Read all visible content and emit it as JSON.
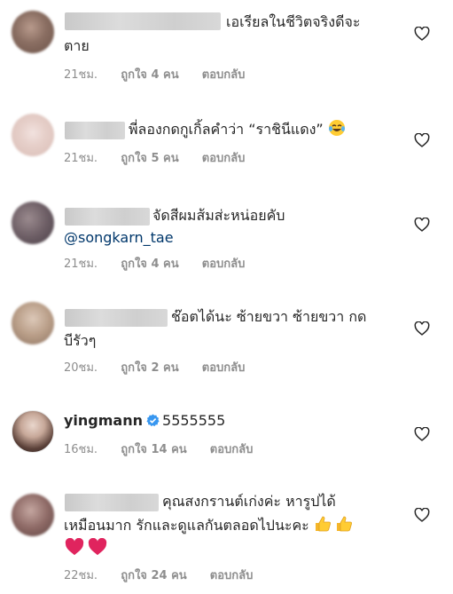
{
  "comments": [
    {
      "username": "",
      "line1": "เอเรียลในชีวิตจริงดีจะ",
      "line2": "ตาย",
      "time": "21ชม.",
      "likes": "ถูกใจ 4 คน",
      "reply": "ตอบกลับ"
    },
    {
      "username": "",
      "line1": "พี่ลองกดกูเกิ้ลคำว่า “ราชินีแดง”",
      "time": "21ชม.",
      "likes": "ถูกใจ 5 คน",
      "reply": "ตอบกลับ"
    },
    {
      "username": "",
      "line1": "จัดสีผมส้มส่ะหน่อยคับ",
      "mention": "@songkarn_tae",
      "time": "21ชม.",
      "likes": "ถูกใจ 4 คน",
      "reply": "ตอบกลับ"
    },
    {
      "username": "",
      "line1": "ช๊อตได้นะ ซ้ายขวา ซ้ายขวา กด",
      "line2": "บีรัวๆ",
      "time": "20ชม.",
      "likes": "ถูกใจ 2 คน",
      "reply": "ตอบกลับ"
    },
    {
      "username": "yingmann",
      "line1": "5555555",
      "time": "16ชม.",
      "likes": "ถูกใจ 14 คน",
      "reply": "ตอบกลับ"
    },
    {
      "username": "",
      "line1": "คุณสงกรานต์เก่งค่ะ หารูปได้",
      "line2": "เหมือนมาก รักและดูแลกันตลอดไปนะคะ",
      "time": "22ชม.",
      "likes": "ถูกใจ 24 คน",
      "reply": "ตอบกลับ"
    }
  ],
  "icons": {
    "like": "heart-outline-icon",
    "verified": "verified-badge-icon",
    "emoji_laugh": "tears-of-joy-emoji",
    "emoji_thumbs": "thumbs-up-emoji",
    "emoji_heart": "red-heart-emoji"
  },
  "colors": {
    "text": "#262626",
    "meta": "#8e8e8e",
    "mention": "#00376b",
    "verified": "#3897f0",
    "heart_outline": "#262626",
    "red_heart": "#e0245e"
  }
}
